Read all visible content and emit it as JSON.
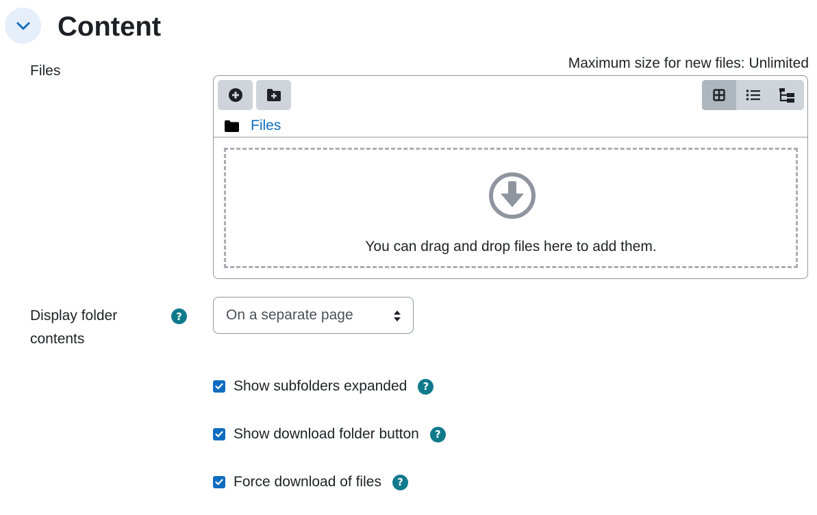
{
  "section": {
    "title": "Content"
  },
  "files": {
    "label": "Files",
    "max_size_text": "Maximum size for new files: Unlimited",
    "path_label": "Files",
    "drop_text": "You can drag and drop files here to add them."
  },
  "display": {
    "label_line1": "Display folder",
    "label_line2": "contents",
    "selected": "On a separate page"
  },
  "options": [
    {
      "label": "Show subfolders expanded",
      "checked": true
    },
    {
      "label": "Show download folder button",
      "checked": true
    },
    {
      "label": "Force download of files",
      "checked": true
    }
  ],
  "help_glyph": "?",
  "colors": {
    "accent": "#0f6cbf",
    "help": "#0f7a8c",
    "toolbar_button": "#ced4da",
    "active_view": "#adb5bd"
  },
  "icons": {
    "collapse": "chevron-down-icon",
    "add_file": "plus-circle-icon",
    "create_folder": "folder-plus-icon",
    "view_grid": "grid-icon",
    "view_list": "list-icon",
    "view_tree": "tree-icon",
    "folder": "folder-icon",
    "drop": "download-circle-icon"
  }
}
